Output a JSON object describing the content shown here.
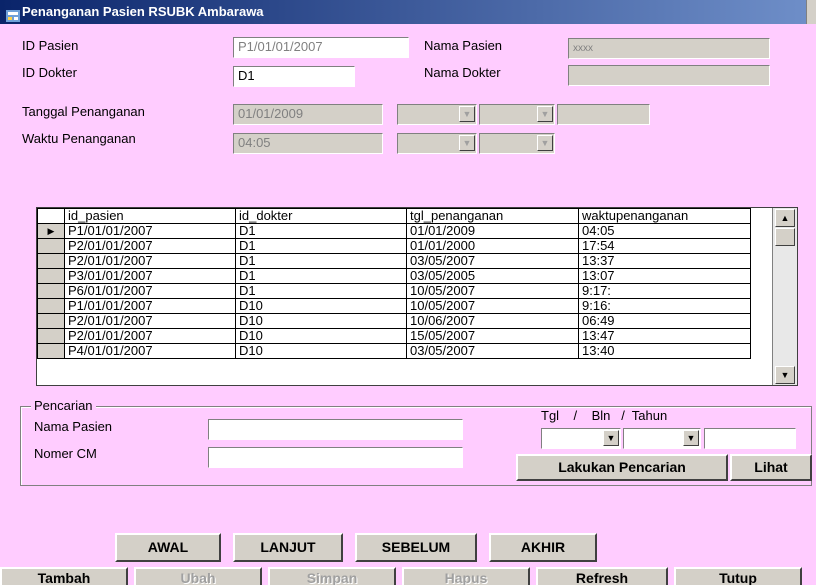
{
  "window": {
    "title": "Penanganan Pasien RSUBK Ambarawa"
  },
  "form": {
    "id_pasien_label": "ID Pasien",
    "id_pasien_value": "P1/01/01/2007",
    "id_dokter_label": "ID Dokter",
    "id_dokter_value": "D1",
    "nama_pasien_label": "Nama Pasien",
    "nama_pasien_value": "xxxx",
    "nama_dokter_label": "Nama Dokter",
    "nama_dokter_value": "",
    "tanggal_label": "Tanggal Penanganan",
    "tanggal_value": "01/01/2009",
    "waktu_label": "Waktu Penanganan",
    "waktu_value": "04:05"
  },
  "grid": {
    "columns": [
      "id_pasien",
      "id_dokter",
      "tgl_penanganan",
      "waktupenanganan"
    ],
    "rows": [
      [
        "P1/01/01/2007",
        "D1",
        "01/01/2009",
        "04:05"
      ],
      [
        "P2/01/01/2007",
        "D1",
        "01/01/2000",
        "17:54"
      ],
      [
        "P2/01/01/2007",
        "D1",
        "03/05/2007",
        "13:37"
      ],
      [
        "P3/01/01/2007",
        "D1",
        "03/05/2005",
        "13:07"
      ],
      [
        "P6/01/01/2007",
        "D1",
        "10/05/2007",
        "9:17:"
      ],
      [
        "P1/01/01/2007",
        "D10",
        "10/05/2007",
        "9:16:"
      ],
      [
        "P2/01/01/2007",
        "D10",
        "10/06/2007",
        "06:49"
      ],
      [
        "P2/01/01/2007",
        "D10",
        "15/05/2007",
        "13:47"
      ],
      [
        "P4/01/01/2007",
        "D10",
        "03/05/2007",
        "13:40"
      ]
    ],
    "current_row_marker": "▶"
  },
  "search": {
    "group_label": "Pencarian",
    "nama_pasien_label": "Nama Pasien",
    "nama_pasien_value": "",
    "nomer_cm_label": "Nomer CM",
    "nomer_cm_value": "",
    "date_header": "Tgl    /    Bln   /  Tahun",
    "search_button": "Lakukan Pencarian",
    "view_button": "Lihat"
  },
  "nav": {
    "first": "AWAL",
    "next": "LANJUT",
    "prev": "SEBELUM",
    "last": "AKHIR"
  },
  "actions": {
    "add": "Tambah",
    "edit": "Ubah",
    "save": "Simpan",
    "delete": "Hapus",
    "refresh": "Refresh",
    "close": "Tutup"
  }
}
